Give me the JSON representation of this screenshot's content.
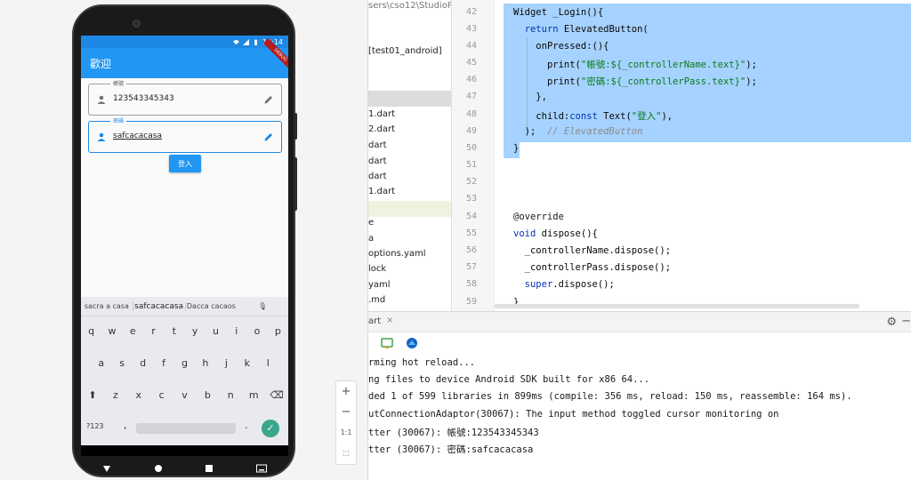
{
  "emulator": {
    "status_time": "14:14",
    "debug_banner": "DEBUG",
    "app_title": "歡迎",
    "field_account": {
      "label": "帳號",
      "value": "123543345343"
    },
    "field_password": {
      "label": "密碼",
      "value": "safcacacasa"
    },
    "login_button": "登入",
    "suggestions": [
      "sacra a casa",
      "safcacacasa",
      "Dacca cacaos"
    ],
    "keys_row1": [
      "q",
      "w",
      "e",
      "r",
      "t",
      "y",
      "u",
      "i",
      "o",
      "p"
    ],
    "keys_row2": [
      "a",
      "s",
      "d",
      "f",
      "g",
      "h",
      "j",
      "k",
      "l"
    ],
    "keys_row3": [
      "z",
      "x",
      "c",
      "v",
      "b",
      "n",
      "m"
    ],
    "key_symbols": "?123",
    "key_comma": ",",
    "key_period": ".",
    "zoom_controls": [
      "+",
      "−",
      "1:1"
    ]
  },
  "project_tree": {
    "lines": [
      "sers\\cso12\\StudioP",
      "",
      "",
      "[test01_android]",
      "",
      "",
      "1.dart",
      "2.dart",
      "dart",
      "dart",
      "dart",
      "1.dart",
      "",
      "e",
      "a",
      "options.yaml",
      "lock",
      "yaml",
      ".md"
    ]
  },
  "editor": {
    "line_numbers": [
      "42",
      "43",
      "44",
      "45",
      "46",
      "47",
      "48",
      "49",
      "50",
      "51",
      "52",
      "53",
      "54",
      "55",
      "56",
      "57",
      "58",
      "59"
    ],
    "code": {
      "l42": "Widget _Login(){",
      "l43_kw": "return",
      "l43_rest": " ElevatedButton(",
      "l44": "onPressed:(){",
      "l45_a": "print(",
      "l45_s": "\"帳號:${_controllerName.text}\"",
      "l45_b": ");",
      "l46_a": "print(",
      "l46_s": "\"密碼:${_controllerPass.text}\"",
      "l46_b": ");",
      "l47": "},",
      "l48_a": "child:",
      "l48_kw": "const",
      "l48_b": " Text(",
      "l48_s": "\"登入\"",
      "l48_c": "),",
      "l49_a": ");",
      "l49_cm": "  // ElevatedButton",
      "l50": "}",
      "l54": "@override",
      "l55_kw": "void",
      "l55_rest": " dispose(){",
      "l56": "_controllerName.dispose();",
      "l57": "_controllerPass.dispose();",
      "l58_kw": "super",
      "l58_rest": ".dispose();",
      "l59": "}"
    }
  },
  "run_panel": {
    "tab_label": "art",
    "close": "×",
    "console_lines": [
      "rming hot reload...",
      "ng files to device Android SDK built for x86 64...",
      "ded 1 of 599 libraries in 899ms (compile: 356 ms, reload: 150 ms, reassemble: 164 ms).",
      "utConnectionAdaptor(30067): The input method toggled cursor monitoring on",
      "tter (30067): 帳號:123543345343",
      "tter (30067): 密碼:safcacacasa"
    ]
  },
  "colors": {
    "primary": "#2196f3",
    "selection": "#a6d2ff",
    "keyword": "#0033b3",
    "string": "#067d17"
  }
}
